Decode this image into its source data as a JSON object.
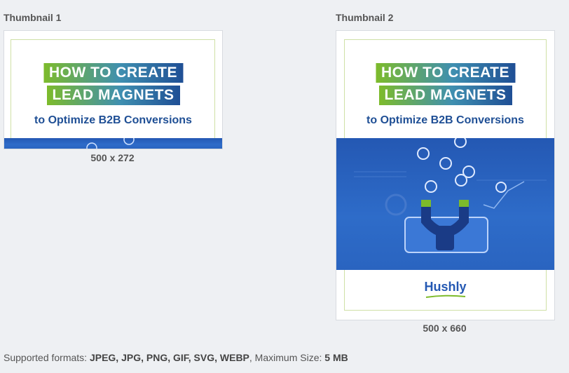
{
  "thumbnails": [
    {
      "label": "Thumbnail 1",
      "size": "500 x 272"
    },
    {
      "label": "Thumbnail 2",
      "size": "500 x 660"
    }
  ],
  "cover": {
    "line1": "HOW TO CREATE",
    "line2": "LEAD MAGNETS",
    "subtitle": "to Optimize B2B Conversions",
    "logo": "Hushly"
  },
  "footer": {
    "prefix": "Supported formats: ",
    "formats": "JPEG, JPG, PNG, GIF, SVG, WEBP",
    "middle": ", Maximum Size: ",
    "max_size": "5 MB"
  },
  "colors": {
    "accent_green": "#7dbb2b",
    "accent_blue": "#1f4f95",
    "band_blue": "#2458b3"
  }
}
